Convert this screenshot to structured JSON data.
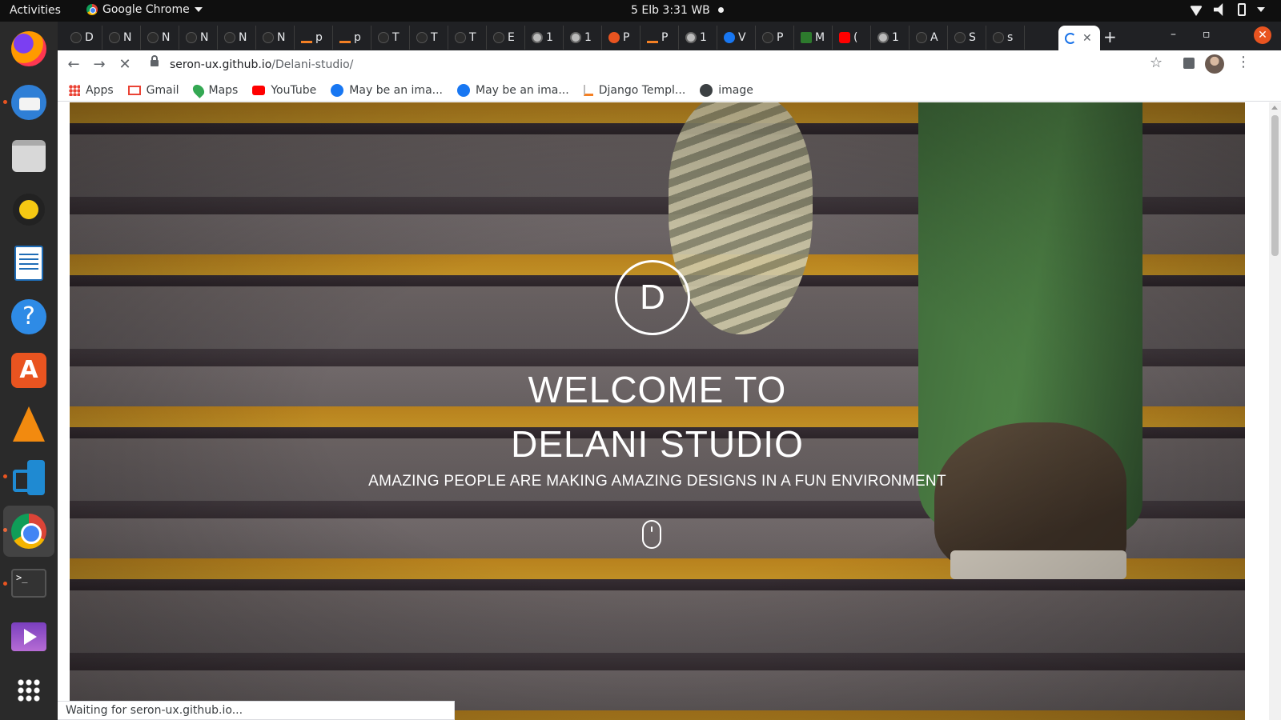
{
  "topbar": {
    "activities": "Activities",
    "app_name": "Google Chrome",
    "clock": "5 Elb  3:31 WB"
  },
  "dock": {
    "items": [
      "firefox",
      "thunderbird",
      "files",
      "rhythmbox",
      "libreoffice-writer",
      "help",
      "ubuntu-software",
      "vlc",
      "vscode",
      "chrome",
      "terminal",
      "video",
      "show-apps"
    ]
  },
  "tabs": [
    {
      "letter": "D",
      "icon": "github"
    },
    {
      "letter": "N",
      "icon": "github"
    },
    {
      "letter": "N",
      "icon": "github"
    },
    {
      "letter": "N",
      "icon": "github"
    },
    {
      "letter": "N",
      "icon": "github"
    },
    {
      "letter": "N",
      "icon": "github"
    },
    {
      "letter": "p",
      "icon": "stackoverflow"
    },
    {
      "letter": "p",
      "icon": "stackoverflow"
    },
    {
      "letter": "T",
      "icon": "github"
    },
    {
      "letter": "T",
      "icon": "github"
    },
    {
      "letter": "T",
      "icon": "github"
    },
    {
      "letter": "E",
      "icon": "github"
    },
    {
      "letter": "1",
      "icon": "web"
    },
    {
      "letter": "1",
      "icon": "web"
    },
    {
      "letter": "P",
      "icon": "orange"
    },
    {
      "letter": "P",
      "icon": "stackoverflow"
    },
    {
      "letter": "1",
      "icon": "web"
    },
    {
      "letter": "V",
      "icon": "facebook"
    },
    {
      "letter": "P",
      "icon": "github"
    },
    {
      "letter": "M",
      "icon": "tree"
    },
    {
      "letter": "(",
      "icon": "youtube"
    },
    {
      "letter": "1",
      "icon": "web"
    },
    {
      "letter": "A",
      "icon": "github"
    },
    {
      "letter": "S",
      "icon": "gear"
    },
    {
      "letter": "s",
      "icon": "github"
    }
  ],
  "active_tab": {
    "close": "✕"
  },
  "omnibox": {
    "host": "seron-ux.github.io",
    "path": "/Delani-studio/"
  },
  "bookmarks": [
    {
      "label": "Apps",
      "icon": "apps"
    },
    {
      "label": "Gmail",
      "icon": "gmail"
    },
    {
      "label": "Maps",
      "icon": "maps"
    },
    {
      "label": "YouTube",
      "icon": "youtube"
    },
    {
      "label": "May be an ima...",
      "icon": "facebook"
    },
    {
      "label": "May be an ima...",
      "icon": "facebook"
    },
    {
      "label": "Django Templ...",
      "icon": "stackoverflow"
    },
    {
      "label": "image",
      "icon": "globe"
    }
  ],
  "hero": {
    "logo_letter": "D",
    "title_line1": "WELCOME TO",
    "title_line2": "DELANI STUDIO",
    "subtitle": "AMAZING PEOPLE ARE MAKING AMAZING DESIGNS IN A FUN ENVIRONMENT"
  },
  "status": "Waiting for seron-ux.github.io..."
}
